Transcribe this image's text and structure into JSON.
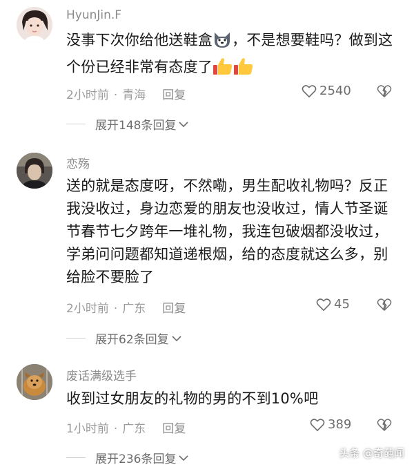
{
  "comments": [
    {
      "username": "HyunJin.F",
      "text_part1": "没事下次你给他送鞋盒",
      "text_part2": "，不是想要鞋吗？做到这个份已经非常有态度了",
      "emoji_1": "dog-face-emoji",
      "emoji_2": "thumbs-up-emoji",
      "time": "2小时前",
      "location": "青海",
      "reply_label": "回复",
      "likes": "2540",
      "expand_label": "展开148条回复"
    },
    {
      "username": "恋殇",
      "text": "送的就是态度呀，不然嘞，男生配收礼物吗？反正我没收过，身边恋爱的朋友也没收过，情人节圣诞节春节七夕跨年一堆礼物，我连包破烟都没收过，学弟问问题都知道递根烟，给的态度就这么多，别给脸不要脸了",
      "time": "2小时前",
      "location": "广东",
      "reply_label": "回复",
      "likes": "45",
      "expand_label": "展开62条回复"
    },
    {
      "username": "废话满级选手",
      "text": "收到过女朋友的礼物的男的不到10%吧",
      "time": "1小时前",
      "location": "广东",
      "reply_label": "回复",
      "likes": "389",
      "expand_label": "展开236条回复"
    }
  ],
  "watermark": "头条 @奇葩闻",
  "icons": {
    "like": "heart-outline-icon",
    "dislike": "broken-heart-icon",
    "expand": "chevron-down-icon"
  },
  "colors": {
    "text": "#1a1a1a",
    "meta": "#9b9b9b",
    "username": "#8a8a8a"
  }
}
